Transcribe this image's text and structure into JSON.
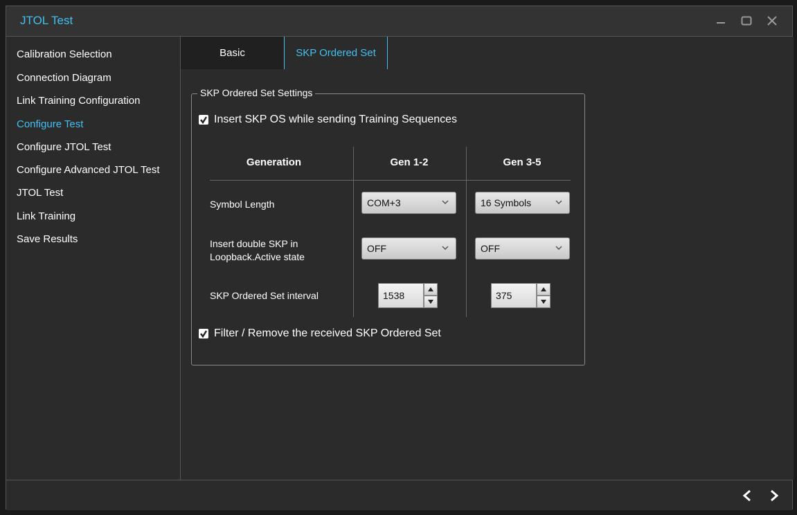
{
  "window": {
    "title": "JTOL Test"
  },
  "sidebar": {
    "items": [
      {
        "label": "Calibration Selection"
      },
      {
        "label": "Connection Diagram"
      },
      {
        "label": "Link Training Configuration"
      },
      {
        "label": "Configure Test",
        "active": true
      },
      {
        "label": "Configure JTOL Test"
      },
      {
        "label": "Configure Advanced JTOL Test"
      },
      {
        "label": "JTOL Test"
      },
      {
        "label": "Link Training"
      },
      {
        "label": "Save Results"
      }
    ]
  },
  "tabs": [
    {
      "label": "Basic"
    },
    {
      "label": "SKP Ordered Set",
      "active": true
    }
  ],
  "skp": {
    "group_title": "SKP Ordered Set Settings",
    "insert_checkbox": {
      "label": "Insert SKP OS while sending Training Sequences",
      "checked": true
    },
    "columns": {
      "generation": "Generation",
      "gen12": "Gen 1-2",
      "gen35": "Gen 3-5"
    },
    "rows": {
      "symbol_length": {
        "label": "Symbol Length",
        "gen12": "COM+3",
        "gen35": "16 Symbols"
      },
      "double_skp": {
        "label_line1": "Insert double SKP in",
        "label_line2": "Loopback.Active state",
        "gen12": "OFF",
        "gen35": "OFF"
      },
      "interval": {
        "label": "SKP Ordered Set interval",
        "gen12": "1538",
        "gen35": "375"
      }
    },
    "filter_checkbox": {
      "label": "Filter / Remove the received SKP Ordered Set",
      "checked": true
    }
  },
  "colors": {
    "accent": "#42c0f0",
    "background": "#2b2b2b"
  },
  "icons": {
    "minimize": "minimize-icon",
    "maximize": "maximize-icon",
    "close": "close-icon",
    "prev": "chevron-left-icon",
    "next": "chevron-right-icon"
  }
}
